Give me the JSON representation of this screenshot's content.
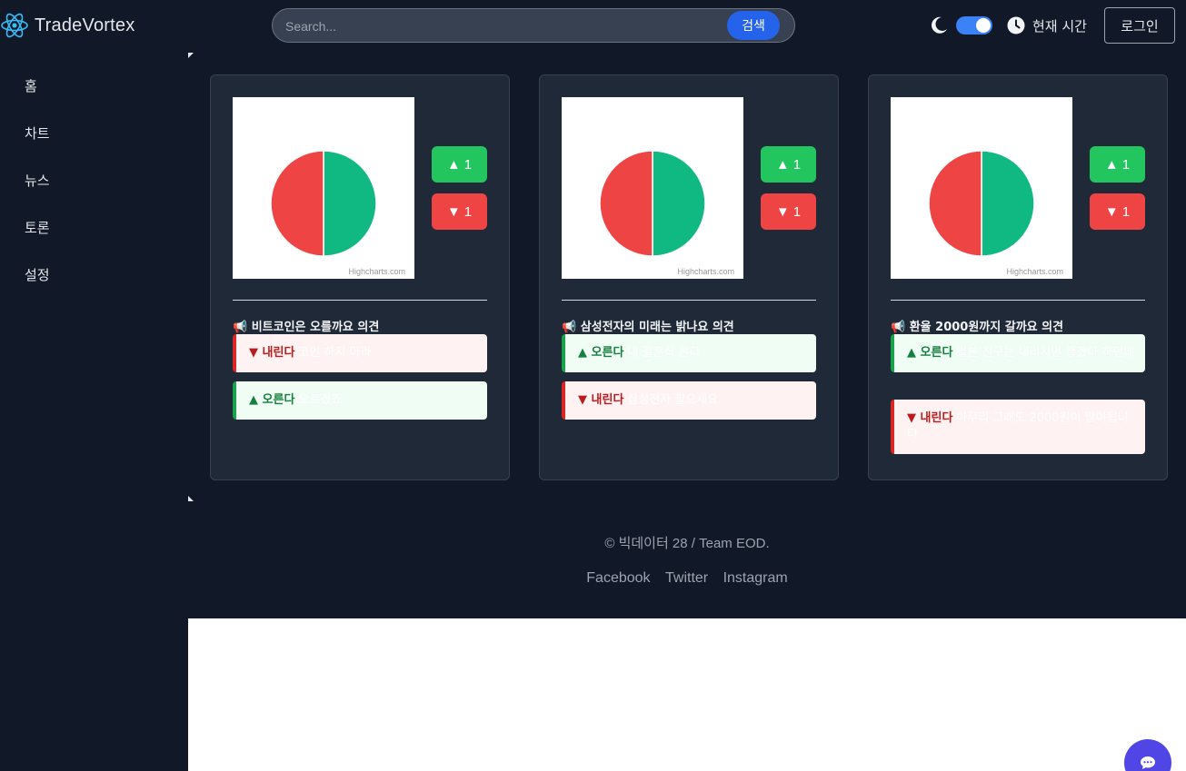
{
  "header": {
    "brand": "TradeVortex",
    "search_placeholder": "Search...",
    "search_button": "검색",
    "time_label": "현재 시간",
    "login_button": "로그인",
    "theme_toggle_on": true
  },
  "sidebar": {
    "items": [
      {
        "label": "홈"
      },
      {
        "label": "차트"
      },
      {
        "label": "뉴스"
      },
      {
        "label": "토론"
      },
      {
        "label": "설정"
      }
    ]
  },
  "colors": {
    "up": "#10b981",
    "down": "#ef4444",
    "accent": "#2563eb"
  },
  "cards": [
    {
      "chart_credit": "Highcharts.com",
      "up_count": "1",
      "down_count": "1",
      "up_share": 0.5,
      "down_share": 0.5,
      "topic": "📢 비트코인은 오를까요 의견",
      "opinions": [
        {
          "type": "down",
          "tag": "▼ 내린다",
          "text": "코인 하지 마라"
        },
        {
          "type": "up",
          "tag": "▲ 오른다",
          "text": "오르겠죠"
        }
      ]
    },
    {
      "chart_credit": "Highcharts.com",
      "up_count": "1",
      "down_count": "1",
      "up_share": 0.5,
      "down_share": 0.5,
      "topic": "📢 삼성전자의 미래는 밝나요 의견",
      "opinions": [
        {
          "type": "up",
          "tag": "▲ 오른다",
          "text": "내 결혼식 온다"
        },
        {
          "type": "down",
          "tag": "▼ 내린다",
          "text": "삼성전자 팔으세요"
        }
      ]
    },
    {
      "chart_credit": "Highcharts.com",
      "up_count": "1",
      "down_count": "1",
      "up_share": 0.5,
      "down_share": 0.5,
      "topic": "📢 환율 2000원까지 갈까요 의견",
      "opinions": [
        {
          "type": "up",
          "tag": "▲ 오른다",
          "text": "일본 친구는 내리시면 좋겠다 하던데"
        },
        {
          "type": "down",
          "tag": "▼ 내린다",
          "text": "아무리 그래도 2000원이 말이됩니다"
        }
      ]
    }
  ],
  "footer": {
    "copyright": "© 빅데이터 28 / Team EOD.",
    "links": [
      "Facebook",
      "Twitter",
      "Instagram"
    ]
  },
  "chat_icon": "chat-bubble-icon"
}
